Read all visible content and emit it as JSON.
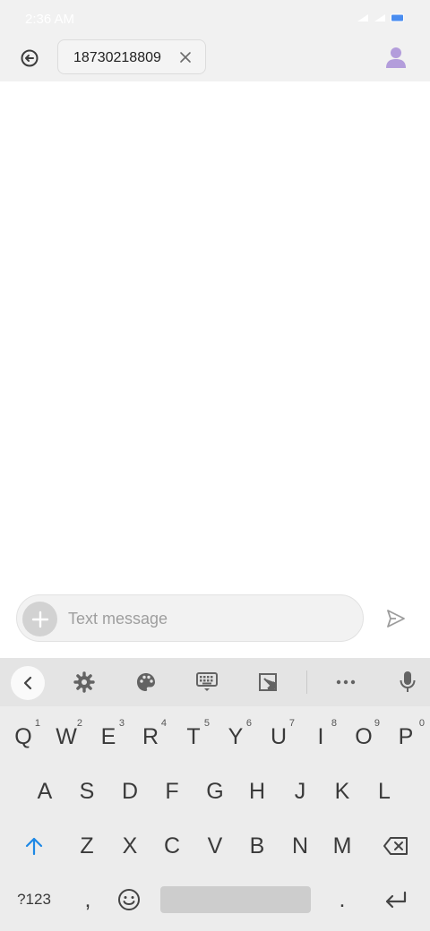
{
  "status_bar": {
    "time": "2:36 AM"
  },
  "header": {
    "recipient": "18730218809"
  },
  "compose": {
    "placeholder": "Text message"
  },
  "keyboard": {
    "row1": [
      {
        "key": "Q",
        "hint": "1"
      },
      {
        "key": "W",
        "hint": "2"
      },
      {
        "key": "E",
        "hint": "3"
      },
      {
        "key": "R",
        "hint": "4"
      },
      {
        "key": "T",
        "hint": "5"
      },
      {
        "key": "Y",
        "hint": "6"
      },
      {
        "key": "U",
        "hint": "7"
      },
      {
        "key": "I",
        "hint": "8"
      },
      {
        "key": "O",
        "hint": "9"
      },
      {
        "key": "P",
        "hint": "0"
      }
    ],
    "row2": [
      "A",
      "S",
      "D",
      "F",
      "G",
      "H",
      "J",
      "K",
      "L"
    ],
    "row3": [
      "Z",
      "X",
      "C",
      "V",
      "B",
      "N",
      "M"
    ],
    "row4": {
      "symbols": "?123",
      "comma": ",",
      "period": "."
    }
  },
  "colors": {
    "accent": "#1e88e5",
    "contact_icon": "#b39ddb",
    "battery": "#4a8df0"
  },
  "icons": {
    "back": "back-arrow-icon",
    "chip_close": "close-icon",
    "contact": "person-icon",
    "attach": "plus-icon",
    "send": "send-icon",
    "toolbar": [
      "chevron-left-icon",
      "gear-icon",
      "palette-icon",
      "keyboard-icon",
      "resize-icon",
      "more-icon",
      "mic-icon"
    ],
    "shift": "shift-icon",
    "backspace": "backspace-icon",
    "emoji": "emoji-icon",
    "enter": "enter-icon"
  }
}
